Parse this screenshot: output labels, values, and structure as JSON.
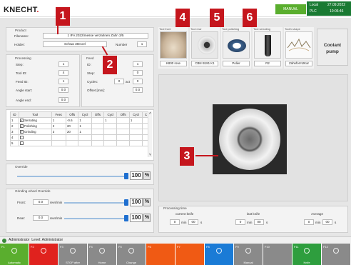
{
  "header": {
    "brand": "KNECHT",
    "mode": "MANUAL",
    "local_label": "Local",
    "plc_label": "PLC",
    "date": "27.09.2022",
    "time": "10:06:46",
    "colors": {
      "brand_red": "#d81e1e",
      "header_green": "#5aae2e",
      "plc_bg": "#1a7a33"
    }
  },
  "callouts": [
    "1",
    "2",
    "3",
    "4",
    "5",
    "6"
  ],
  "product": {
    "title": "Product",
    "filename_label": "Filename:",
    "filename_value": "1 IFA 2022\\messe verzahnen Zahn 3/5",
    "holder_label": "Holder:",
    "holder_value": "Schwa 360.xel",
    "number_label": "Number",
    "number_value": "1"
  },
  "processing": {
    "title": "Processing",
    "step_label": "Step:",
    "step_value": "1",
    "tool_id_label": "Tool ID:",
    "tool_id_value": "4",
    "feed_id_label": "Feed ID:",
    "feed_id_value": "1",
    "angle_start_label": "Angle start:",
    "angle_start_value": "0.0",
    "angle_end_label": "Angle end:",
    "angle_end_value": "0.0"
  },
  "feed": {
    "title": "Feed",
    "id_label": "ID:",
    "id_value": "1",
    "step_label": "Step:",
    "step_value": "0",
    "cycles_label": "Cycles:",
    "cycles_value": "0",
    "act_label": "act",
    "act_value": "0",
    "offset_label": "Offset [mm]:",
    "offset_value": "0.0"
  },
  "tool_table": {
    "headers": [
      "ID",
      "Tool",
      "Feec",
      "Offs",
      "Cycl",
      "Offs",
      "Cycl",
      "Offs",
      "Cycl",
      "C"
    ],
    "rows": [
      {
        "id": "1",
        "checked": true,
        "tool": "Serrating",
        "c1": "1",
        "c2": "-0.6",
        "c3": "1",
        "c4": "",
        "c5": "1",
        "c6": "",
        "c7": "1"
      },
      {
        "id": "2",
        "checked": true,
        "tool": "Polishing",
        "c1": "2",
        "c2": "20",
        "c3": "1",
        "c4": "",
        "c5": "",
        "c6": "",
        "c7": ""
      },
      {
        "id": "3",
        "checked": true,
        "tool": "Grinding",
        "c1": "3",
        "c2": "20",
        "c3": "1",
        "c4": "",
        "c5": "",
        "c6": "",
        "c7": ""
      },
      {
        "id": "4",
        "checked": false,
        "tool": "",
        "c1": "",
        "c2": "",
        "c3": "",
        "c4": "",
        "c5": "",
        "c6": "",
        "c7": ""
      },
      {
        "id": "5",
        "checked": false,
        "tool": "",
        "c1": "",
        "c2": "",
        "c3": "",
        "c4": "",
        "c5": "",
        "c6": "",
        "c7": ""
      }
    ]
  },
  "override": {
    "title": "Override",
    "value": "100",
    "unit": "%",
    "level": 1.0
  },
  "grinding_override": {
    "title": "Grinding wheel Override",
    "front_label": "Front:",
    "front_value": "0.0",
    "front_unit": "revs/min",
    "front_pct": "100",
    "front_level": 1.0,
    "rear_label": "Rear:",
    "rear_value": "0.0",
    "rear_unit": "revs/min",
    "rear_pct": "100",
    "rear_level": 1.0,
    "unit": "%"
  },
  "tools_top": [
    {
      "title": "Tool front",
      "name": "K800 rose",
      "icon": "wheel-photo-icon"
    },
    {
      "title": "Tool rear",
      "name": "CBN B181 K1",
      "icon": "wheel-photo-icon"
    },
    {
      "title": "Tool polishing",
      "name": "Polier",
      "icon": "polishing-wheel-icon"
    },
    {
      "title": "Tool serrating",
      "name": "R2",
      "icon": "serrating-tool-icon"
    },
    {
      "title": "Tooth shape",
      "name": "Zahnform2Kar",
      "icon": "tooth-shape-icon"
    }
  ],
  "coolant_button": {
    "line1": "Coolant",
    "line2": "pump"
  },
  "processing_time": {
    "title": "Processing time",
    "current_label": "current knife",
    "last_label": "last knife",
    "average_label": "Average",
    "min": "min",
    "s": "s",
    "current_min": "0",
    "current_s": "00",
    "last_min": "0",
    "last_s": "00",
    "avg_min": "0",
    "avg_s": "00"
  },
  "status_bar": {
    "icon": "person-icon",
    "text": "Administrator  Level: Administrator"
  },
  "fkeys": [
    {
      "fn": "F1",
      "label": "Automatic",
      "color": "#5aae2e",
      "icon": "auto-icon"
    },
    {
      "fn": "F2",
      "label": "",
      "color": "#e0221e",
      "icon": "stop-icon"
    },
    {
      "fn": "F3",
      "label": "STOP after",
      "color": "#8a8a8a",
      "icon": "stop-after-icon"
    },
    {
      "fn": "F4",
      "label": "Home",
      "color": "#8a8a8a",
      "icon": "home-icon"
    },
    {
      "fn": "F5",
      "label": "Change",
      "color": "#8a8a8a",
      "icon": "change-icon"
    },
    {
      "fn": "F6",
      "label": "",
      "color": "#f05a14",
      "icon": ""
    },
    {
      "fn": "F7",
      "label": "",
      "color": "#f05a14",
      "icon": ""
    },
    {
      "fn": "F8",
      "label": "",
      "color": "#1a7bd6",
      "icon": "pen-icon"
    },
    {
      "fn": "F9",
      "label": "Manual",
      "color": "#8a8a8a",
      "icon": "manual-icon"
    },
    {
      "fn": "F10",
      "label": "",
      "color": "#8a8a8a",
      "icon": ""
    },
    {
      "fn": "F11",
      "label": "Knife",
      "color": "#2e9e3e",
      "icon": "knife-icon"
    },
    {
      "fn": "F12",
      "label": "",
      "color": "#8a8a8a",
      "icon": "plus-icon"
    }
  ]
}
